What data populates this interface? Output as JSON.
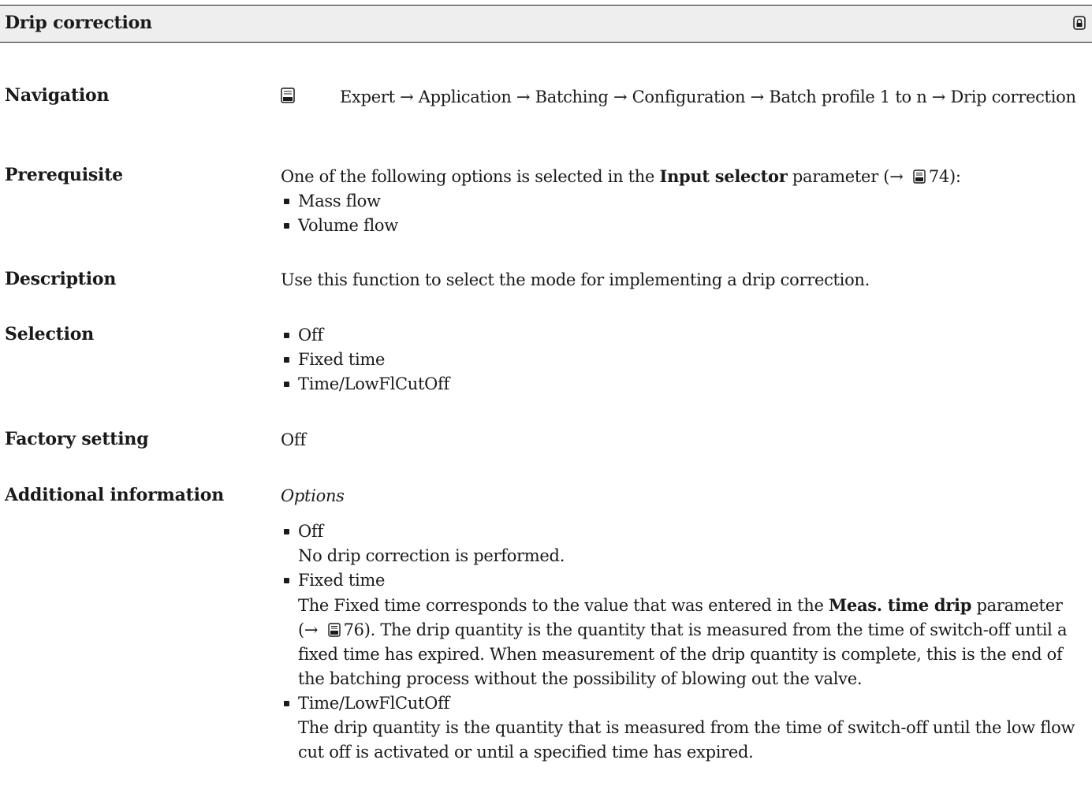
{
  "header": {
    "title": "Drip correction"
  },
  "navigation": {
    "label": "Navigation",
    "path": "Expert → Application → Batching → Configuration → Batch profile 1 to n → Drip correction"
  },
  "prerequisite": {
    "label": "Prerequisite",
    "text_before": "One of the following options is selected in the ",
    "param": "Input selector",
    "text_after": " parameter (→ ",
    "page_ref": "74",
    "text_end": "):",
    "options": [
      "Mass flow",
      "Volume flow"
    ]
  },
  "description": {
    "label": "Description",
    "text": "Use this function to select the mode for implementing a drip correction."
  },
  "selection": {
    "label": "Selection",
    "options": [
      "Off",
      "Fixed time",
      "Time/LowFlCutOff"
    ]
  },
  "factory_setting": {
    "label": "Factory setting",
    "value": "Off"
  },
  "additional": {
    "label": "Additional information",
    "subheading": "Options",
    "off": {
      "title": "Off",
      "text": "No drip correction is performed."
    },
    "fixed": {
      "title": "Fixed time",
      "text_before": "The Fixed time corresponds to the value that was entered in the ",
      "param": "Meas. time drip",
      "text_mid": "parameter (→ ",
      "page_ref": "76",
      "text_after": "). The drip quantity is the quantity that is measured from the time of switch-off until a fixed time has expired. When measurement of the drip quantity is complete, this is the end of the batching process without the possibility of blowing out the valve."
    },
    "time_lfco": {
      "title": "Time/LowFlCutOff",
      "text": "The drip quantity is the quantity that is measured from the time of switch-off until the low flow cut off is activated or until a specified time has expired."
    }
  }
}
